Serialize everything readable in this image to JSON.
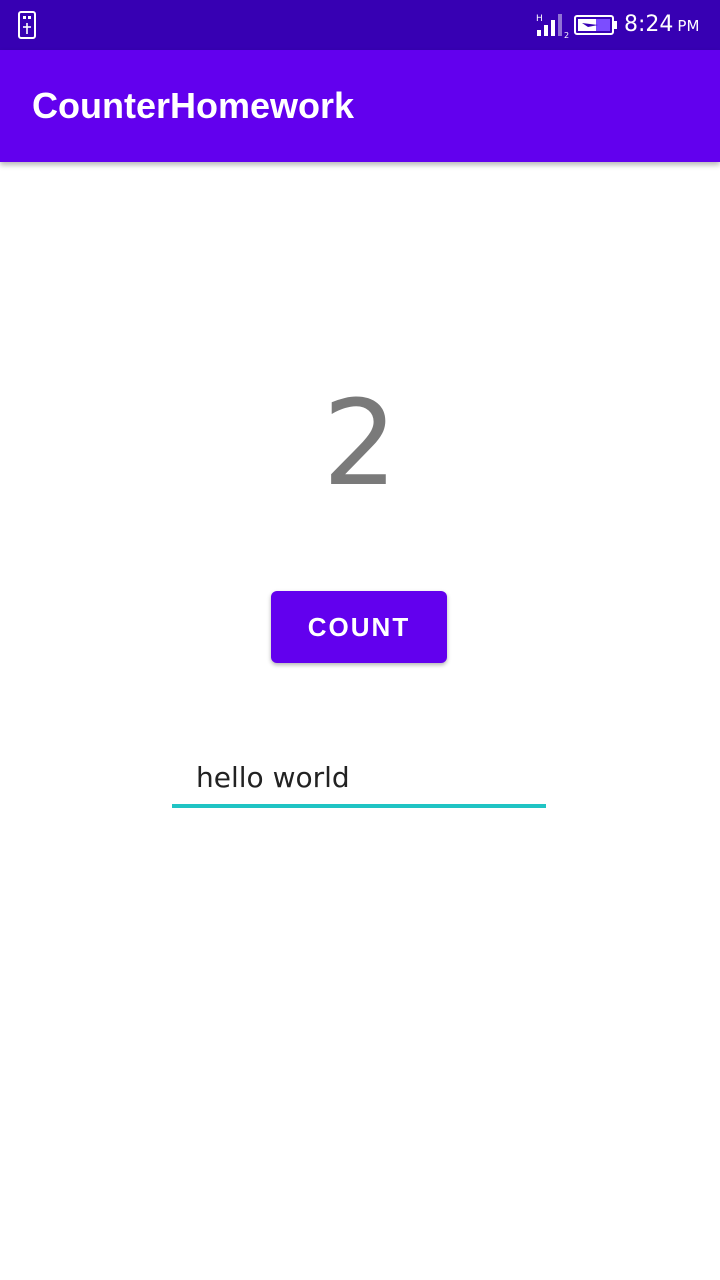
{
  "status_bar": {
    "time": "8:24",
    "ampm": "PM",
    "network_label": "H",
    "sim_slot": "2",
    "icons": [
      "usb-icon",
      "signal-icon",
      "battery-icon"
    ]
  },
  "app_bar": {
    "title": "CounterHomework"
  },
  "main": {
    "counter_value": "2",
    "count_button_label": "COUNT",
    "text_input_value": "hello world"
  },
  "colors": {
    "status_bar": "#3700b3",
    "primary": "#6200ee",
    "accent_underline": "#20c4c4",
    "counter_text": "#7a7a7a"
  }
}
